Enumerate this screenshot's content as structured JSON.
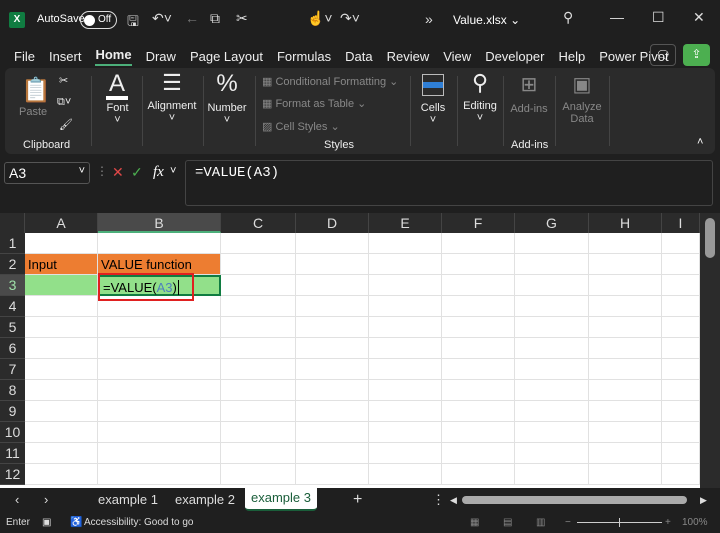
{
  "titlebar": {
    "autosave": "AutoSave",
    "toggle": "Off",
    "filename": "Value.xlsx ⌄"
  },
  "menu": [
    "File",
    "Insert",
    "Home",
    "Draw",
    "Page Layout",
    "Formulas",
    "Data",
    "Review",
    "View",
    "Developer",
    "Help",
    "Power Pivot"
  ],
  "ribbon": {
    "paste": "Paste",
    "clipboard": "Clipboard",
    "font": "Font",
    "alignment": "Alignment",
    "number": "Number",
    "cond": "Conditional Formatting ⌄",
    "table": "Format as Table ⌄",
    "styles_btn": "Cell Styles ⌄",
    "styles": "Styles",
    "cells": "Cells",
    "editing": "Editing",
    "addins_btn": "Add-ins",
    "addins": "Add-ins",
    "analyze": "Analyze",
    "analyze2": "Data"
  },
  "formula_bar": {
    "name_box": "A3",
    "fx": "fx",
    "formula": "=VALUE(A3)"
  },
  "columns": [
    "A",
    "B",
    "C",
    "D",
    "E",
    "F",
    "G",
    "H",
    "I"
  ],
  "rows": [
    "1",
    "2",
    "3",
    "4",
    "5",
    "6",
    "7",
    "8",
    "9",
    "10",
    "11",
    "12"
  ],
  "cells": {
    "A2": "Input",
    "B2": "VALUE function",
    "B3_prefix": "=VALUE(",
    "B3_ref": "A3",
    "B3_suffix": ")"
  },
  "colors": {
    "orange": "#ed7d31",
    "green": "#92e08a",
    "ref_blue": "#4f81bd",
    "accent": "#107c41"
  },
  "sheets": [
    "example 1",
    "example 2",
    "example 3"
  ],
  "active_sheet": "example 3",
  "status": {
    "mode": "Enter",
    "accessibility": "Accessibility: Good to go",
    "zoom": "100%"
  }
}
